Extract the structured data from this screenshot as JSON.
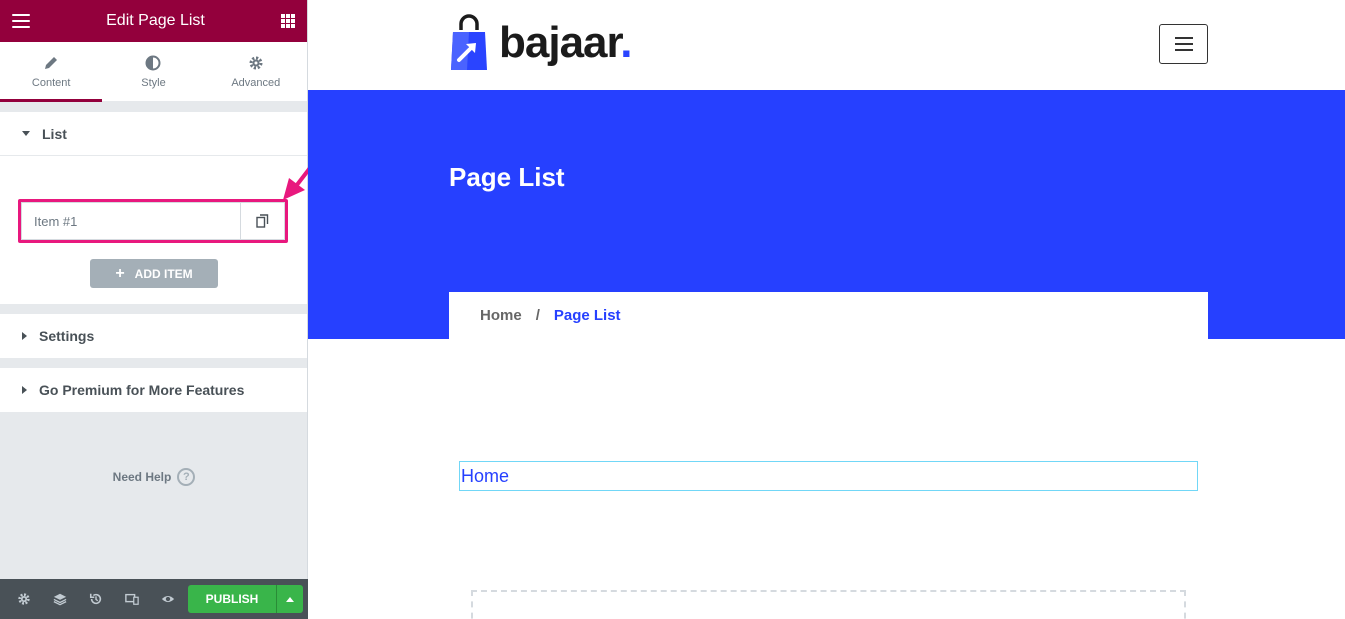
{
  "panel": {
    "title": "Edit Page List",
    "tabs": [
      {
        "label": "Content",
        "icon": "pencil-icon",
        "active": true
      },
      {
        "label": "Style",
        "icon": "half-circle-icon",
        "active": false
      },
      {
        "label": "Advanced",
        "icon": "gear-icon",
        "active": false
      }
    ],
    "sections": {
      "list": "List",
      "settings": "Settings",
      "premium": "Go Premium for More Features"
    },
    "repeater_items": [
      {
        "label": "Item #1"
      }
    ],
    "add_item_label": "ADD ITEM",
    "need_help": "Need Help",
    "help_icon_glyph": "?",
    "publish_label": "PUBLISH",
    "colors": {
      "header": "#93003c",
      "publish": "#39b54a",
      "highlight": "#e8187e"
    }
  },
  "preview": {
    "logo_text": "bajaar",
    "logo_dot": ".",
    "hero_title": "Page List",
    "breadcrumb": {
      "home": "Home",
      "separator": "/",
      "current": "Page List"
    },
    "page_list_items": [
      {
        "label": "Home"
      }
    ],
    "colors": {
      "hero": "#2640ff",
      "link": "#2640ff"
    }
  }
}
